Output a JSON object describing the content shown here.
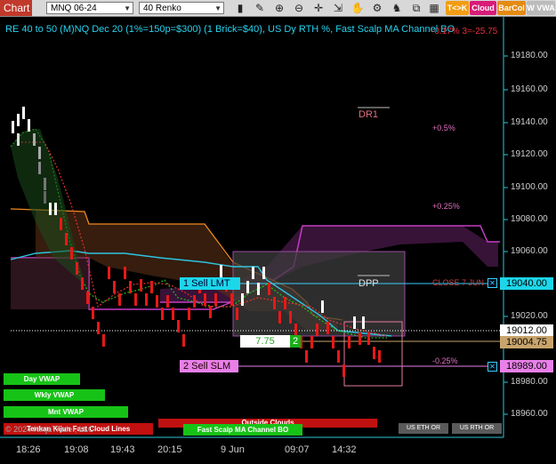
{
  "toolbar": {
    "chart_label": "Chart",
    "instrument": "MNQ 06-24",
    "bar_type": "40 Renko",
    "btn_tk": "T<>K",
    "btn_cloud": "Cloud",
    "btn_barcol": "BarCol",
    "btn_vwap": "W VWA",
    "icons": [
      "bar-style-icon",
      "draw-tools-icon",
      "zoom-in-icon",
      "zoom-out-icon",
      "crosshair-icon",
      "pan-icon",
      "hand-icon",
      "properties-icon",
      "strategy-icon",
      "indicators-icon",
      "templates-icon",
      "data-box-icon"
    ]
  },
  "chart": {
    "header": "RE 40 to 50 (M)NQ Dec 20 (1%=150p=$300) (1 Brick=$40), US Dy RTH %, Fast Scalp MA Channel BO",
    "header_red": "-0.17% 3=-25.75",
    "price_labels": [
      "19180.00",
      "19160.00",
      "19140.00",
      "19120.00",
      "19100.00",
      "19080.00",
      "19060.00",
      "19020.00",
      "18980.00",
      "18960.00"
    ],
    "time_labels": [
      "18:26",
      "19:08",
      "19:43",
      "20:15",
      "9 Jun",
      "09:07",
      "14:32"
    ],
    "levels": {
      "dr1": "DR1",
      "dpp": "DPP",
      "plus05": "+0.5%",
      "plus025": "+0.25%",
      "close": "CLOSE 7 JUN",
      "minus025": "-0.25%"
    },
    "orders": {
      "sell_lmt": "1 Sell LMT",
      "sell_slm": "2 Sell SLM",
      "pnl": "7.75",
      "qty": "2"
    },
    "price_tags": {
      "p1": "19040.00",
      "p2": "19012.00",
      "p3": "19004.75",
      "p4": "18989.00"
    },
    "legend": {
      "day_vwap": "Day VWAP",
      "wkly_vwap": "Wkly VWAP",
      "mnt_vwap": "Mnt VWAP",
      "copyright": "© 2024 NinjaTrader, LLC",
      "kinja_lines": "Tenkan Kijun Fast Cloud Lines",
      "outside_clouds": "Outside Clouds",
      "fast_scalp": "Fast Scalp MA Channel BO",
      "us_eth": "US ETH OR",
      "us_rth": "US RTH OR"
    },
    "colors": {
      "accent_cyan": "#27d3f0",
      "up_brick": "#ffffff",
      "down_brick": "#e81818",
      "magenta": "#c43dc4",
      "orange": "#f08a1c"
    }
  }
}
